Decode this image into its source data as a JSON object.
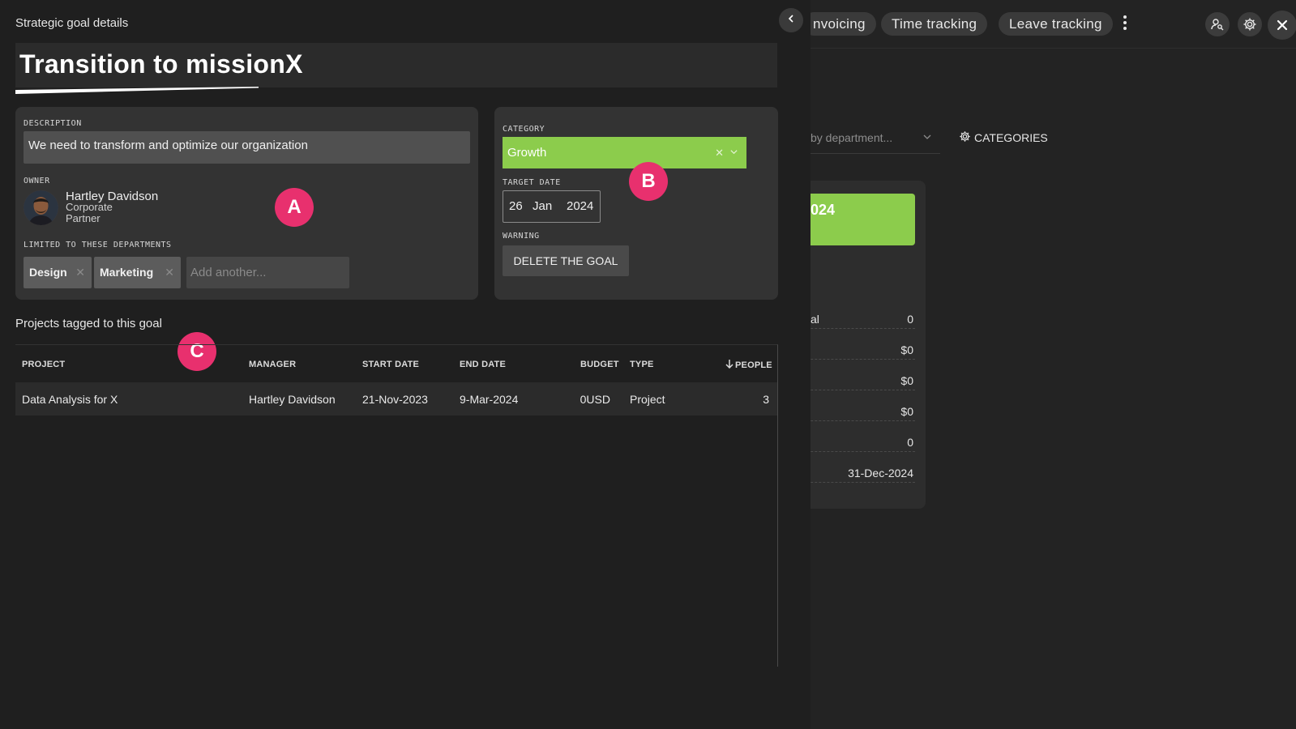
{
  "background": {
    "nav_pills": [
      "nvoicing",
      "Time tracking",
      "Leave tracking"
    ],
    "filter_placeholder": "by department...",
    "categories_label": "CATEGORIES",
    "card_title_fragment": "024",
    "rows": [
      {
        "label": "al",
        "value": "0"
      },
      {
        "label": "",
        "value": "$0"
      },
      {
        "label": "",
        "value": "$0"
      },
      {
        "label": "",
        "value": "$0"
      },
      {
        "label": "",
        "value": "0"
      },
      {
        "label": "",
        "value": "31-Dec-2024"
      }
    ],
    "icons": [
      "user-search-icon",
      "gear-icon",
      "close-icon"
    ]
  },
  "panel": {
    "heading": "Strategic goal details",
    "title": "Transition to missionX",
    "description_label": "DESCRIPTION",
    "description": "We need to transform and optimize our organization",
    "owner_label": "OWNER",
    "owner": {
      "name": "Hartley Davidson",
      "line1": "Corporate",
      "line2": "Partner"
    },
    "departments_label": "LIMITED TO THESE DEPARTMENTS",
    "departments": [
      "Design",
      "Marketing"
    ],
    "add_placeholder": "Add another...",
    "category_label": "CATEGORY",
    "category": "Growth",
    "category_color": "#8ccc4c",
    "target_date_label": "TARGET DATE",
    "target_date": {
      "day": "26",
      "month": "Jan",
      "year": "2024"
    },
    "warning_label": "WARNING",
    "delete_button": "DELETE THE GOAL"
  },
  "markers": [
    "A",
    "B",
    "C"
  ],
  "projects": {
    "heading": "Projects tagged to this goal",
    "columns": [
      "PROJECT",
      "MANAGER",
      "START DATE",
      "END DATE",
      "BUDGET",
      "TYPE",
      "PEOPLE"
    ],
    "rows": [
      {
        "project": "Data Analysis for X",
        "manager": "Hartley Davidson",
        "start": "21-Nov-2023",
        "end": "9-Mar-2024",
        "budget": "0USD",
        "type": "Project",
        "people": "3"
      }
    ]
  }
}
